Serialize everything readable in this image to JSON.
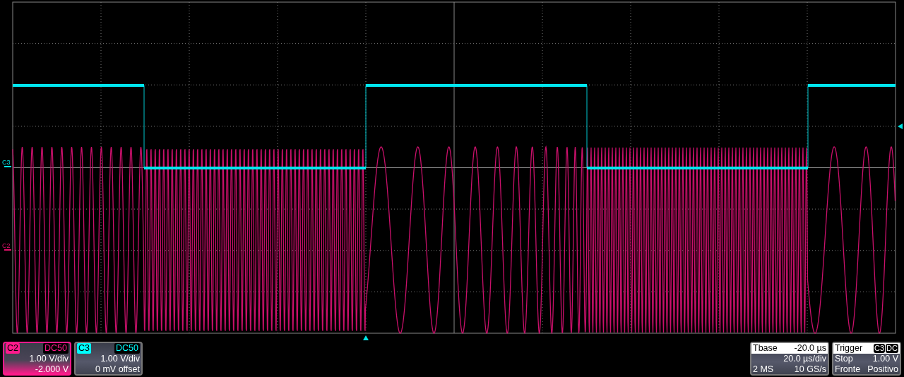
{
  "channel_markers": [
    {
      "label": "C3",
      "color": "#00e5e5"
    },
    {
      "label": "C2",
      "color": "#e0106a"
    }
  ],
  "channels": [
    {
      "name": "C2",
      "coupling": "DC50",
      "scale": "1.00 V/div",
      "offset": "-2.000 V",
      "color": "#ff1a8c",
      "selected": true
    },
    {
      "name": "C3",
      "coupling": "DC50",
      "scale": "1.00 V/div",
      "offset": "0 mV offset",
      "color": "#00ffff",
      "selected": false
    }
  ],
  "timebase": {
    "label": "Tbase",
    "delay": "-20.0 µs",
    "scale": "20.0 µs/div",
    "memory": "2 MS",
    "sample_rate": "10 GS/s"
  },
  "trigger": {
    "label": "Trigger",
    "source": "C3",
    "coupling": "DC",
    "mode": "Stop",
    "level": "1.00 V",
    "slope": "Fronte",
    "polarity": "Positivo"
  }
}
